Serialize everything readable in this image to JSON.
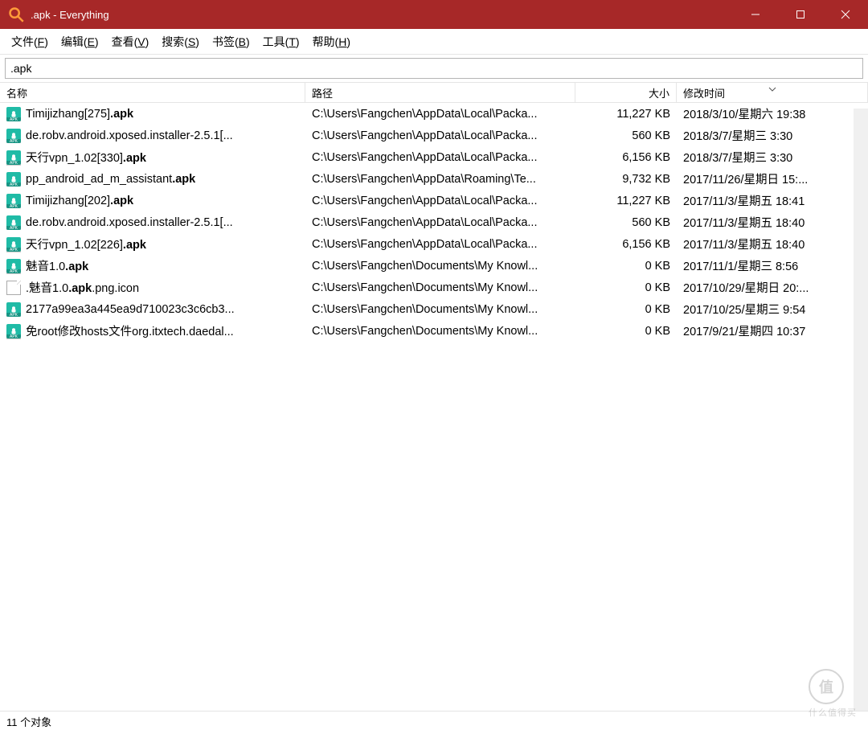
{
  "window": {
    "title": ".apk - Everything"
  },
  "menu": {
    "file": "文件(F)",
    "edit": "编辑(E)",
    "view": "查看(V)",
    "search": "搜索(S)",
    "bookmarks": "书签(B)",
    "tools": "工具(T)",
    "help": "帮助(H)"
  },
  "search_value": ".apk",
  "columns": {
    "name": "名称",
    "path": "路径",
    "size": "大小",
    "date": "修改时间"
  },
  "rows": [
    {
      "icon": "apk",
      "name_pre": "Timijizhang[275]",
      "name_bold": ".apk",
      "name_post": "",
      "path": "C:\\Users\\Fangchen\\AppData\\Local\\Packa...",
      "size": "11,227 KB",
      "date": "2018/3/10/星期六 19:38"
    },
    {
      "icon": "apk",
      "name_pre": "de.robv.android.xposed.installer-2.5.1[...",
      "name_bold": "",
      "name_post": "",
      "path": "C:\\Users\\Fangchen\\AppData\\Local\\Packa...",
      "size": "560 KB",
      "date": "2018/3/7/星期三 3:30"
    },
    {
      "icon": "apk",
      "name_pre": "天行vpn_1.02[330]",
      "name_bold": ".apk",
      "name_post": "",
      "path": "C:\\Users\\Fangchen\\AppData\\Local\\Packa...",
      "size": "6,156 KB",
      "date": "2018/3/7/星期三 3:30"
    },
    {
      "icon": "apk",
      "name_pre": "pp_android_ad_m_assistant",
      "name_bold": ".apk",
      "name_post": "",
      "path": "C:\\Users\\Fangchen\\AppData\\Roaming\\Te...",
      "size": "9,732 KB",
      "date": "2017/11/26/星期日 15:..."
    },
    {
      "icon": "apk",
      "name_pre": "Timijizhang[202]",
      "name_bold": ".apk",
      "name_post": "",
      "path": "C:\\Users\\Fangchen\\AppData\\Local\\Packa...",
      "size": "11,227 KB",
      "date": "2017/11/3/星期五 18:41"
    },
    {
      "icon": "apk",
      "name_pre": "de.robv.android.xposed.installer-2.5.1[...",
      "name_bold": "",
      "name_post": "",
      "path": "C:\\Users\\Fangchen\\AppData\\Local\\Packa...",
      "size": "560 KB",
      "date": "2017/11/3/星期五 18:40"
    },
    {
      "icon": "apk",
      "name_pre": "天行vpn_1.02[226]",
      "name_bold": ".apk",
      "name_post": "",
      "path": "C:\\Users\\Fangchen\\AppData\\Local\\Packa...",
      "size": "6,156 KB",
      "date": "2017/11/3/星期五 18:40"
    },
    {
      "icon": "apk",
      "name_pre": "魅音1.0",
      "name_bold": ".apk",
      "name_post": "",
      "path": "C:\\Users\\Fangchen\\Documents\\My Knowl...",
      "size": "0 KB",
      "date": "2017/11/1/星期三 8:56"
    },
    {
      "icon": "blank",
      "name_pre": ".魅音1.0",
      "name_bold": ".apk",
      "name_post": ".png.icon",
      "path": "C:\\Users\\Fangchen\\Documents\\My Knowl...",
      "size": "0 KB",
      "date": "2017/10/29/星期日 20:..."
    },
    {
      "icon": "apk",
      "name_pre": "2177a99ea3a445ea9d710023c3c6cb3...",
      "name_bold": "",
      "name_post": "",
      "path": "C:\\Users\\Fangchen\\Documents\\My Knowl...",
      "size": "0 KB",
      "date": "2017/10/25/星期三 9:54"
    },
    {
      "icon": "apk",
      "name_pre": "免root修改hosts文件org.itxtech.daedal...",
      "name_bold": "",
      "name_post": "",
      "path": "C:\\Users\\Fangchen\\Documents\\My Knowl...",
      "size": "0 KB",
      "date": "2017/9/21/星期四 10:37"
    }
  ],
  "status": "11 个对象",
  "watermark": {
    "char": "值",
    "text": "什么值得买"
  }
}
